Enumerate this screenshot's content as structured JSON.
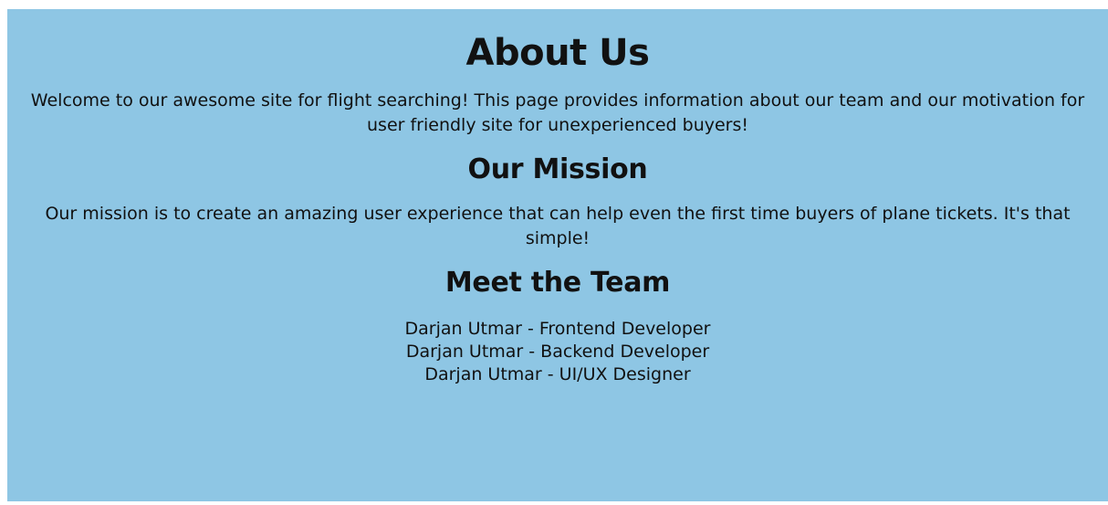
{
  "about": {
    "title": "About Us",
    "intro": "Welcome to our awesome site for flight searching! This page provides information about our team and our motivation for user friendly site for unexperienced buyers!"
  },
  "mission": {
    "heading": "Our Mission",
    "text": "Our mission is to create an amazing user experience that can help even the first time buyers of plane tickets. It's that simple!"
  },
  "team": {
    "heading": "Meet the Team",
    "members": [
      "Darjan Utmar - Frontend Developer",
      "Darjan Utmar - Backend Developer",
      "Darjan Utmar - UI/UX Designer"
    ]
  },
  "colors": {
    "background": "#8ec6e4",
    "text": "#111111"
  }
}
